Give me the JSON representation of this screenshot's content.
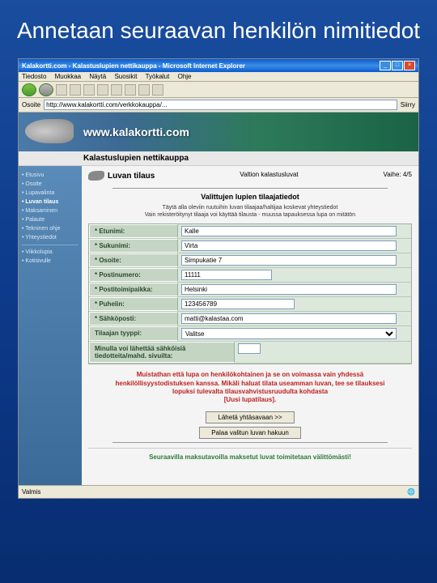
{
  "slide_title": "Annetaan seuraavan henkilön nimitiedot",
  "browser": {
    "title": "Kalakortti.com - Kalastuslupien nettikauppa - Microsoft Internet Explorer",
    "menu": [
      "Tiedosto",
      "Muokkaa",
      "Näytä",
      "Suosikit",
      "Työkalut",
      "Ohje"
    ],
    "addr_label": "Osoite",
    "addr_value": "http://www.kalakortti.com/verkkokauppa/...",
    "go": "Siirry"
  },
  "banner": {
    "url": "www.kalakortti.com",
    "subtitle": "Kalastuslupien nettikauppa"
  },
  "sidebar": {
    "items": [
      {
        "label": "Etusivu",
        "bold": false
      },
      {
        "label": "Osoite",
        "bold": false
      },
      {
        "label": "Lupavalinta",
        "bold": false
      },
      {
        "label": "Luvan tilaus",
        "bold": true
      },
      {
        "label": "Maksaminen",
        "bold": false
      },
      {
        "label": "Palaute",
        "bold": false
      },
      {
        "label": "Tekninen ohje",
        "bold": false
      },
      {
        "label": "Yhteystiedot",
        "bold": false
      }
    ],
    "items2": [
      {
        "label": "Viikkolupia"
      },
      {
        "label": "Kotisivulle"
      }
    ]
  },
  "page": {
    "crumb_title": "Luvan tilaus",
    "crumb_mid": "Valtion kalastusluvat",
    "crumb_step": "Vaihe: 4/5",
    "section_title": "Valittujen lupien tilaajatiedot",
    "hint1": "Täytä alla oleviin ruutuihin luvan tilaajaa/haltijaa koskevat yhteystiedot",
    "hint2": "Vain rekisteröitynyt tilaaja voi käyttää tilausta - muussa tapauksessa lupa on mitätön"
  },
  "form": {
    "rows": [
      {
        "label": "* Etunimi:",
        "value": "Kalle"
      },
      {
        "label": "* Sukunimi:",
        "value": "Virta"
      },
      {
        "label": "* Osoite:",
        "value": "Simpukatie 7"
      },
      {
        "label": "* Postinumero:",
        "value": "11111"
      },
      {
        "label": "* Postitoimipaikka:",
        "value": "Helsinki"
      },
      {
        "label": "* Puhelin:",
        "value": "123456789"
      },
      {
        "label": "* Sähköposti:",
        "value": "matti@kalastaa.com"
      }
    ],
    "type_label": "Tilaajan tyyppi:",
    "type_value": "Valitse",
    "last_label": "Minulla voi lähettää sähköisiä tiedotteita/mahd. sivuilta:"
  },
  "notice": {
    "text": "Muistathan että lupa on henkilökohtainen ja se on voimassa vain yhdessä henkilöllisyystodistuksen kanssa. Mikäli haluat tilata useamman luvan, tee se tilauksesi lopuksi tulevalta tilausvahvistusruudulta kohdasta",
    "link": "[Uusi lupatilaus]."
  },
  "buttons": {
    "submit": "Lähetä yhtäsavaan >>",
    "back": "Palaa valitun luvan hakuun"
  },
  "footer": "Seuraavilla maksutavoilla maksetut luvat toimitetaan välittömästi!",
  "status": "Valmis"
}
